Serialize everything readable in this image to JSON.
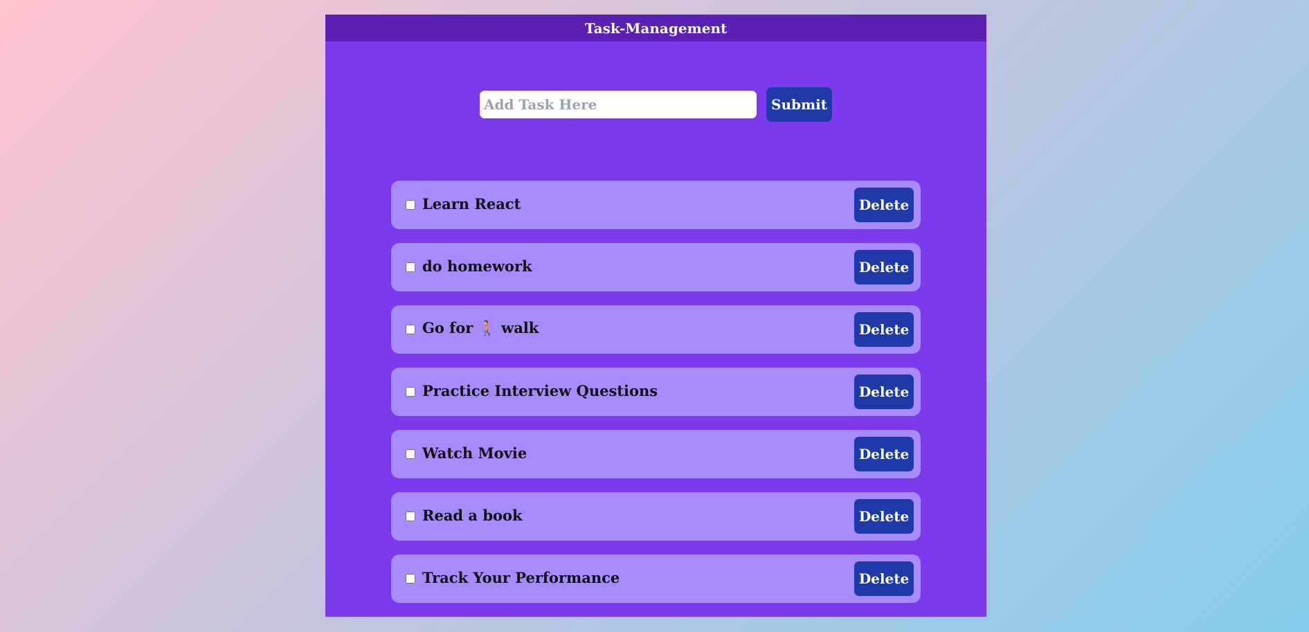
{
  "app": {
    "title": "Task-Management"
  },
  "form": {
    "placeholder": "Add Task Here",
    "value": "",
    "submit_label": "Submit"
  },
  "tasks": [
    {
      "text": "Learn React",
      "checked": false,
      "delete_label": "Delete"
    },
    {
      "text": "do homework",
      "checked": false,
      "delete_label": "Delete"
    },
    {
      "text": "Go for 🚶 walk",
      "checked": false,
      "delete_label": "Delete"
    },
    {
      "text": "Practice Interview Questions",
      "checked": false,
      "delete_label": "Delete"
    },
    {
      "text": "Watch Movie",
      "checked": false,
      "delete_label": "Delete"
    },
    {
      "text": "Read a book",
      "checked": false,
      "delete_label": "Delete"
    },
    {
      "text": "Track Your Performance",
      "checked": false,
      "delete_label": "Delete"
    }
  ],
  "colors": {
    "app_bg": "#7c3aed",
    "header_bg": "#5b21b6",
    "task_bg": "#a78bfa",
    "button_bg": "#1e3aaa"
  }
}
